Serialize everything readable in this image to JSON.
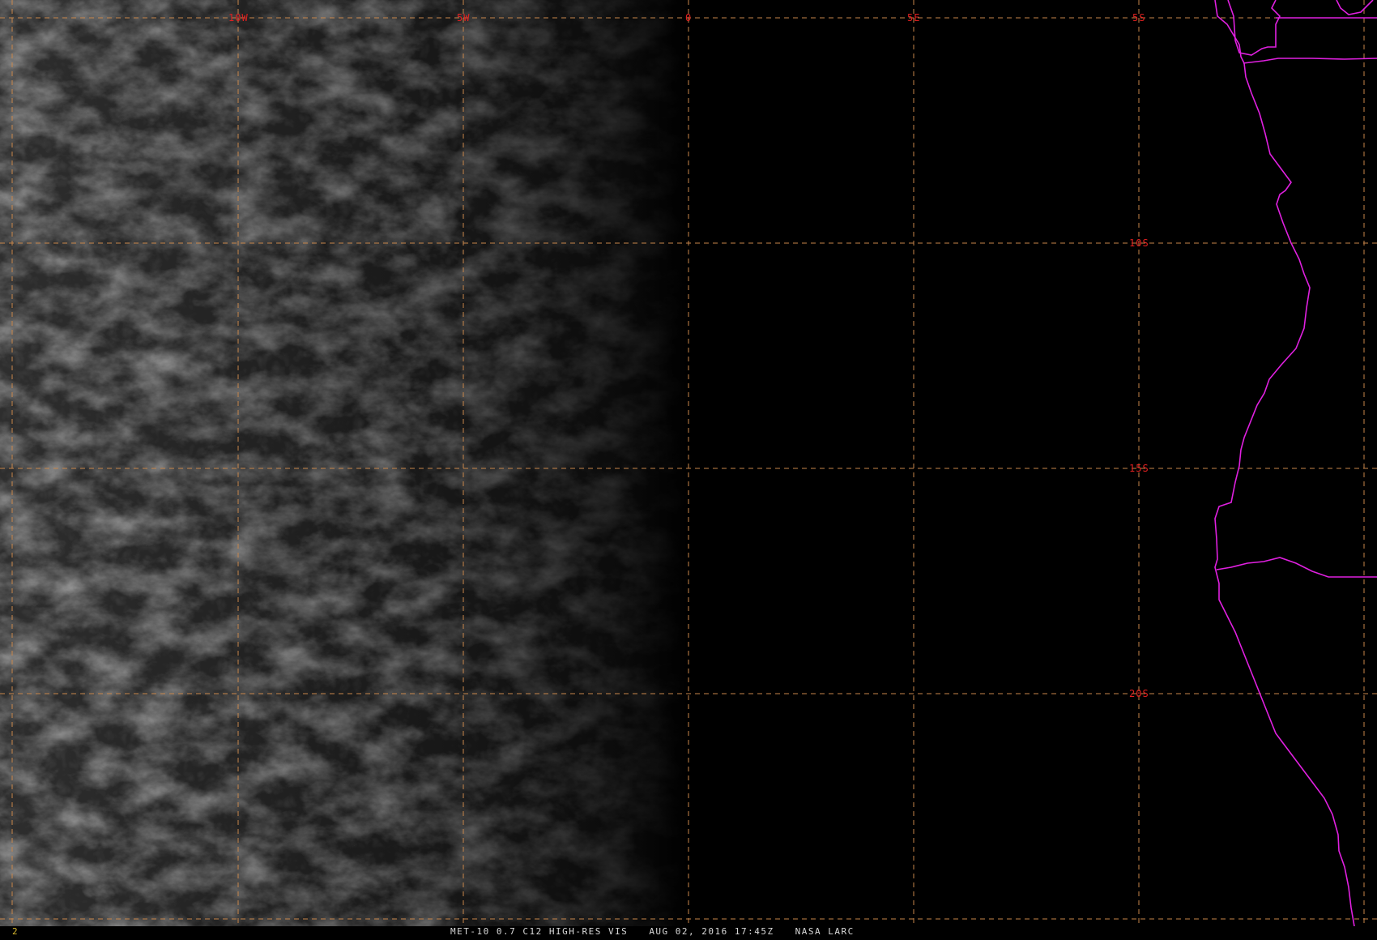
{
  "map": {
    "lon_labels": [
      "10W",
      "5W",
      "0",
      "5E"
    ],
    "lat_labels": [
      "5S",
      "10S",
      "15S",
      "20S"
    ],
    "colors": {
      "grid": "#c8864a",
      "grid_label": "#e02020",
      "boundary": "#e020e0",
      "background": "#000000"
    }
  },
  "footer": {
    "frame_number": "2",
    "satellite": "MET-10 0.7 C12 HIGH-RES VIS",
    "datetime": "AUG 02, 2016 17:45Z",
    "source": "NASA LARC"
  }
}
